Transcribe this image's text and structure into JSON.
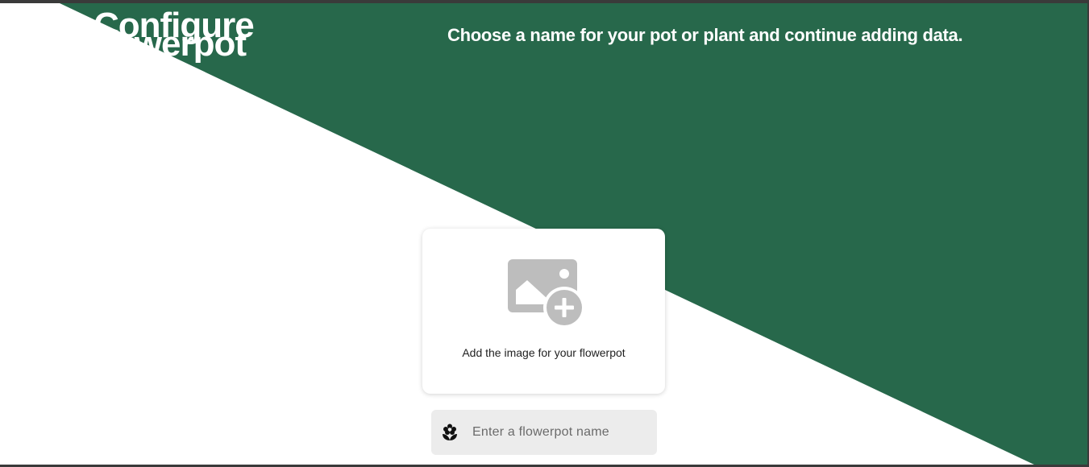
{
  "header": {
    "title": "Configure flowerpot",
    "subtitle": "Choose a name for your pot or plant and continue adding data."
  },
  "image_card": {
    "icon": "add-photo-icon",
    "label": "Add the image for your flowerpot"
  },
  "name_field": {
    "icon": "local-florist-icon",
    "placeholder": "Enter a flowerpot name",
    "value": ""
  },
  "colors": {
    "brand_green": "#27684b",
    "card_bg": "#ffffff",
    "field_bg": "#ececec",
    "icon_gray": "#bdbdbd"
  }
}
